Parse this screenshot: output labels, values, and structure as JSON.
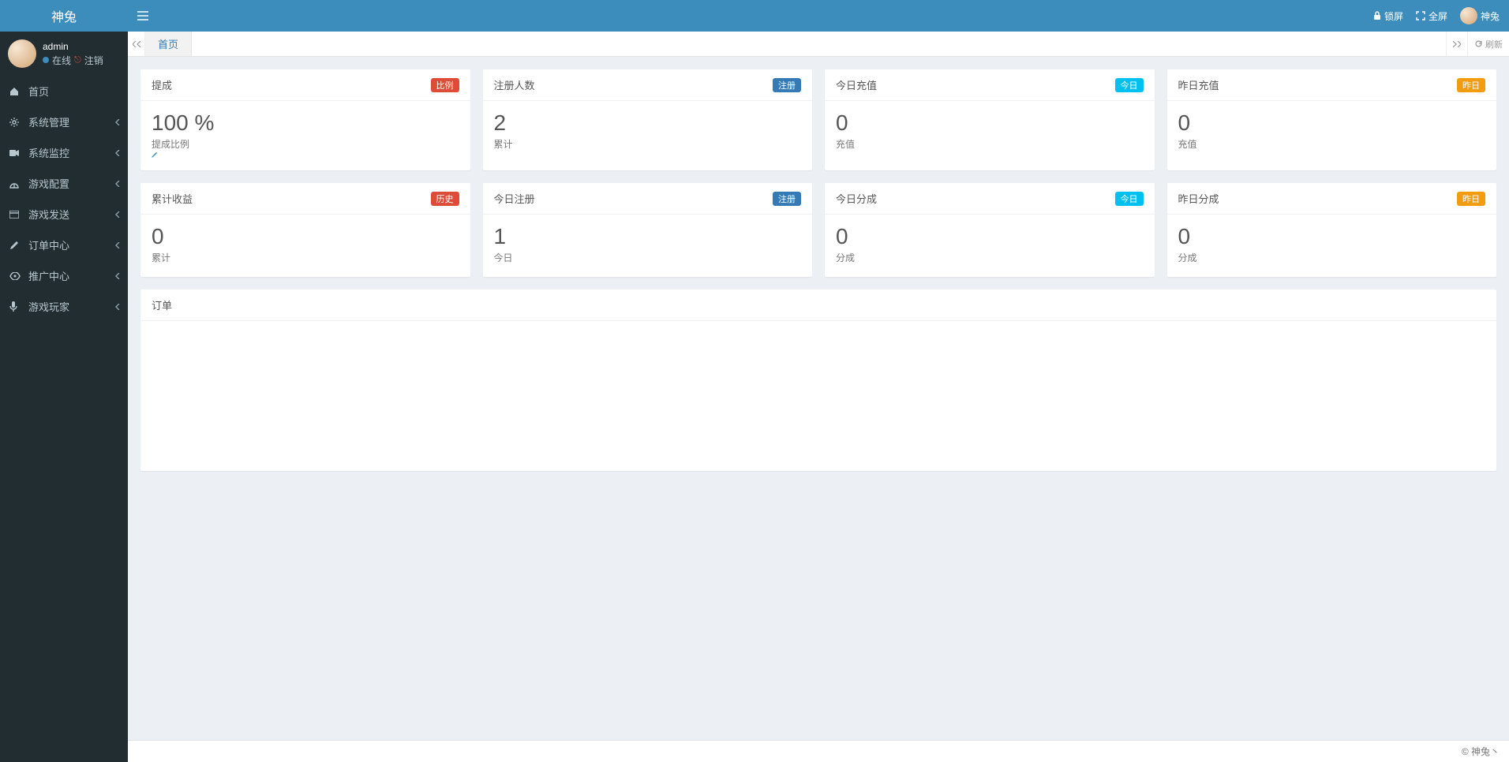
{
  "app": {
    "name": "神兔",
    "user": {
      "name": "admin",
      "status_online": "在线",
      "logout": "注销"
    }
  },
  "topbar": {
    "lockscreen": "锁屏",
    "fullscreen": "全屏",
    "username": "神兔"
  },
  "tabs": {
    "home": "首页",
    "refresh": "刷新"
  },
  "sidebar": {
    "items": [
      {
        "icon": "home",
        "label": "首页",
        "expandable": false
      },
      {
        "icon": "gear",
        "label": "系统管理",
        "expandable": true
      },
      {
        "icon": "camera",
        "label": "系统监控",
        "expandable": true
      },
      {
        "icon": "dashboard",
        "label": "游戏配置",
        "expandable": true
      },
      {
        "icon": "box",
        "label": "游戏发送",
        "expandable": true
      },
      {
        "icon": "pencil",
        "label": "订单中心",
        "expandable": true
      },
      {
        "icon": "eye",
        "label": "推广中心",
        "expandable": true
      },
      {
        "icon": "mic",
        "label": "游戏玩家",
        "expandable": true
      }
    ]
  },
  "cards": [
    {
      "title": "提成",
      "badge_text": "比例",
      "badge_color": "#dd4b39",
      "value": "100 %",
      "sub": "提成比例",
      "show_edit": true
    },
    {
      "title": "注册人数",
      "badge_text": "注册",
      "badge_color": "#337ab7",
      "value": "2",
      "sub": "累计",
      "show_edit": false
    },
    {
      "title": "今日充值",
      "badge_text": "今日",
      "badge_color": "#00c0ef",
      "value": "0",
      "sub": "充值",
      "show_edit": false
    },
    {
      "title": "昨日充值",
      "badge_text": "昨日",
      "badge_color": "#f39c12",
      "value": "0",
      "sub": "充值",
      "show_edit": false
    },
    {
      "title": "累计收益",
      "badge_text": "历史",
      "badge_color": "#dd4b39",
      "value": "0",
      "sub": "累计",
      "show_edit": false
    },
    {
      "title": "今日注册",
      "badge_text": "注册",
      "badge_color": "#337ab7",
      "value": "1",
      "sub": "今日",
      "show_edit": false
    },
    {
      "title": "今日分成",
      "badge_text": "今日",
      "badge_color": "#00c0ef",
      "value": "0",
      "sub": "分成",
      "show_edit": false
    },
    {
      "title": "昨日分成",
      "badge_text": "昨日",
      "badge_color": "#f39c12",
      "value": "0",
      "sub": "分成",
      "show_edit": false
    }
  ],
  "panel": {
    "title": "订单"
  },
  "footer": {
    "copyright": "© 神兔丶"
  }
}
